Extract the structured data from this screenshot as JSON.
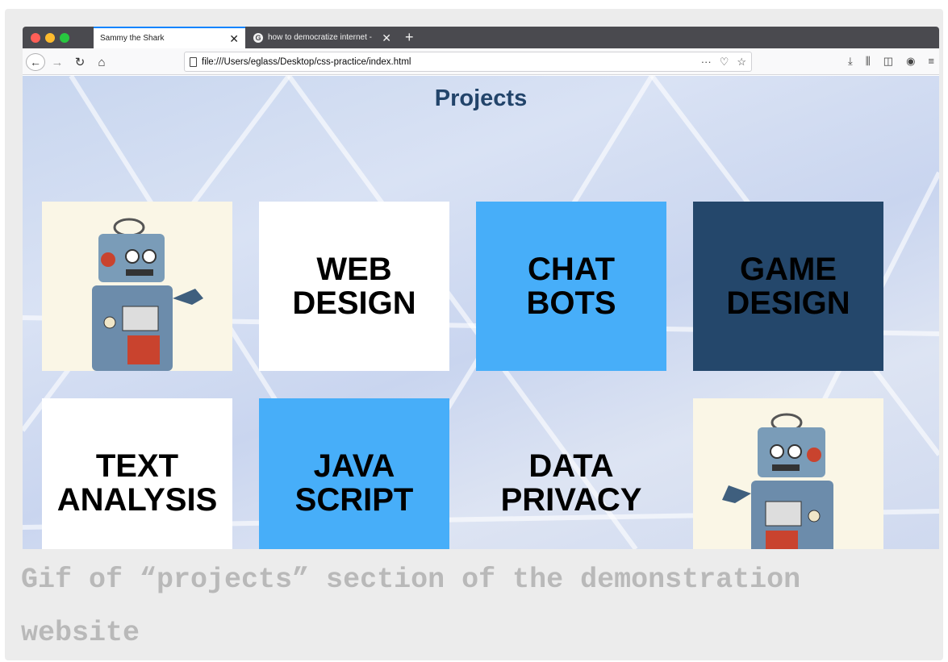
{
  "browser": {
    "tabs": [
      {
        "label": "Sammy the Shark",
        "active": true
      },
      {
        "label": "how to democratize internet - ",
        "active": false
      }
    ],
    "url": "file:///Users/eglass/Desktop/css-practice/index.html",
    "url_actions": [
      "···",
      "pocket-icon",
      "star-icon"
    ],
    "toolbar_icons": [
      "back-icon",
      "forward-icon",
      "reload-icon",
      "home-icon",
      "download-icon",
      "library-icon",
      "sidebar-icon",
      "account-icon",
      "menu-icon"
    ]
  },
  "page": {
    "title": "Projects",
    "tiles": [
      {
        "kind": "image",
        "label": "",
        "icon": "robot-image"
      },
      {
        "kind": "text",
        "label": "WEB\nDESIGN",
        "bg": "#ffffff"
      },
      {
        "kind": "text",
        "label": "CHAT\nBOTS",
        "bg": "#47aef9"
      },
      {
        "kind": "text",
        "label": "GAME\nDESIGN",
        "bg": "#24476b"
      },
      {
        "kind": "text",
        "label": "TEXT\nANALYSIS",
        "bg": "#ffffff"
      },
      {
        "kind": "text",
        "label": "JAVA\nSCRIPT",
        "bg": "#47aef9"
      },
      {
        "kind": "text",
        "label": "DATA\nPRIVACY",
        "bg": "transparent"
      },
      {
        "kind": "image",
        "label": "",
        "icon": "robot-image"
      }
    ]
  },
  "caption": "Gif of “projects” section of the demonstration website",
  "colors": {
    "title": "#22446a",
    "blue_tile": "#47aef9",
    "navy_tile": "#24476b",
    "caption": "#b9b9b9"
  }
}
